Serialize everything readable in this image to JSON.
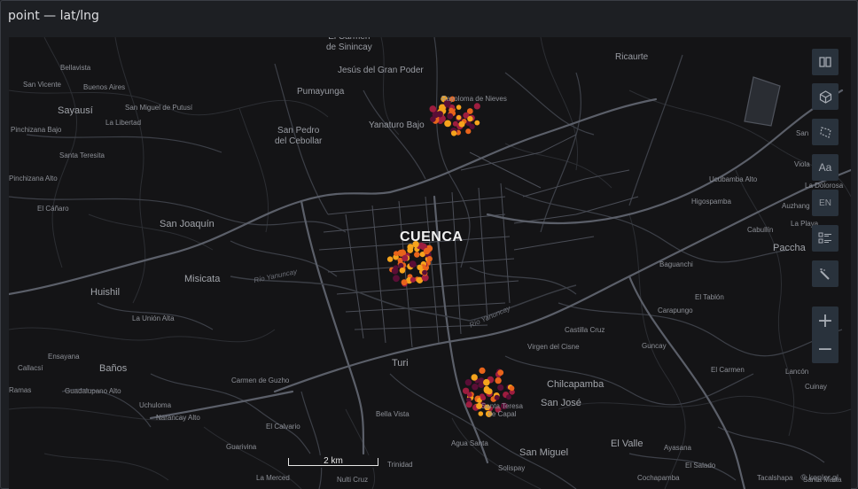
{
  "panel": {
    "title": "point — lat/lng"
  },
  "map": {
    "city": "CUENCA",
    "places": [
      {
        "text": "El Carmen\nde Sinincay",
        "size": "md"
      },
      {
        "text": "Jesús del Gran Poder",
        "size": "md"
      },
      {
        "text": "Ricaurte",
        "size": "md"
      },
      {
        "text": "Bellavista",
        "size": "sm"
      },
      {
        "text": "San Vicente",
        "size": "sm"
      },
      {
        "text": "Buenos Aires",
        "size": "sm"
      },
      {
        "text": "Pumayunga",
        "size": "md"
      },
      {
        "text": "Rayoloma de Nieves",
        "size": "sm"
      },
      {
        "text": "Sayausí",
        "size": "lg"
      },
      {
        "text": "San Miguel de Putusí",
        "size": "sm"
      },
      {
        "text": "La Libertad",
        "size": "sm"
      },
      {
        "text": "Yanaturo Bajo",
        "size": "md"
      },
      {
        "text": "Pinchizana Bajo",
        "size": "sm"
      },
      {
        "text": "San Pedro\ndel Cebollar",
        "size": "md"
      },
      {
        "text": "San",
        "size": "sm"
      },
      {
        "text": "Santa Teresita",
        "size": "sm"
      },
      {
        "text": "Viola",
        "size": "sm"
      },
      {
        "text": "Pinchizana Alto",
        "size": "sm"
      },
      {
        "text": "Ucubamba Alto",
        "size": "sm"
      },
      {
        "text": "La Dolorosa",
        "size": "sm"
      },
      {
        "text": "El Cáñaro",
        "size": "sm"
      },
      {
        "text": "Higospamba",
        "size": "sm"
      },
      {
        "text": "Auzhang",
        "size": "sm"
      },
      {
        "text": "San Joaquín",
        "size": "lg"
      },
      {
        "text": "La Playa",
        "size": "sm"
      },
      {
        "text": "Cabullín",
        "size": "sm"
      },
      {
        "text": "Paccha",
        "size": "lg"
      },
      {
        "text": "Baguanchi",
        "size": "sm"
      },
      {
        "text": "Misicata",
        "size": "lg"
      },
      {
        "text": "Huishil",
        "size": "lg"
      },
      {
        "text": "El Tablón",
        "size": "sm"
      },
      {
        "text": "La Unión Alta",
        "size": "sm"
      },
      {
        "text": "Carapungo",
        "size": "sm"
      },
      {
        "text": "Castilla Cruz",
        "size": "sm"
      },
      {
        "text": "Ensayana",
        "size": "sm"
      },
      {
        "text": "Virgen del Cisne",
        "size": "sm"
      },
      {
        "text": "Guncay",
        "size": "sm"
      },
      {
        "text": "Callacsí",
        "size": "sm"
      },
      {
        "text": "Baños",
        "size": "lg"
      },
      {
        "text": "Turi",
        "size": "lg"
      },
      {
        "text": "El Carmen",
        "size": "sm"
      },
      {
        "text": "Lancón",
        "size": "sm"
      },
      {
        "text": "Carmen de Guzho",
        "size": "sm"
      },
      {
        "text": "Chilcapamba",
        "size": "lg"
      },
      {
        "text": "Cuinay",
        "size": "sm"
      },
      {
        "text": "Guadalupano Alto",
        "size": "sm"
      },
      {
        "text": "Uchuloma",
        "size": "sm"
      },
      {
        "text": "San José",
        "size": "lg"
      },
      {
        "text": "Narancay Alto",
        "size": "sm"
      },
      {
        "text": "Bella Vista",
        "size": "sm"
      },
      {
        "text": "Santa Teresa\nde Capal",
        "size": "sm"
      },
      {
        "text": "El Calvario",
        "size": "sm"
      },
      {
        "text": "Agua Santa",
        "size": "sm"
      },
      {
        "text": "El Valle",
        "size": "lg"
      },
      {
        "text": "Guarivina",
        "size": "sm"
      },
      {
        "text": "San Miguel",
        "size": "lg"
      },
      {
        "text": "Ayasana",
        "size": "sm"
      },
      {
        "text": "Trinidad",
        "size": "sm"
      },
      {
        "text": "Solispay",
        "size": "sm"
      },
      {
        "text": "El Salado",
        "size": "sm"
      },
      {
        "text": "La Merced",
        "size": "sm"
      },
      {
        "text": "Nulti Cruz",
        "size": "sm"
      },
      {
        "text": "Cochapamba",
        "size": "sm"
      },
      {
        "text": "Tacalshapa",
        "size": "sm"
      },
      {
        "text": "Santa Marta",
        "size": "sm"
      },
      {
        "text": "Ramas",
        "size": "sm"
      }
    ],
    "rivers": [
      "Río Yanuncay",
      "Río Yanuncay"
    ],
    "scale_label": "2 km",
    "attribution": "© kepler.gl",
    "point_colors": [
      "#f5a31c",
      "#e8641b",
      "#9e1d3f",
      "#5a0e36"
    ]
  },
  "controls": {
    "lang_label": "EN",
    "text_label": "Aa",
    "zoom_in": "+",
    "zoom_out": "−"
  }
}
